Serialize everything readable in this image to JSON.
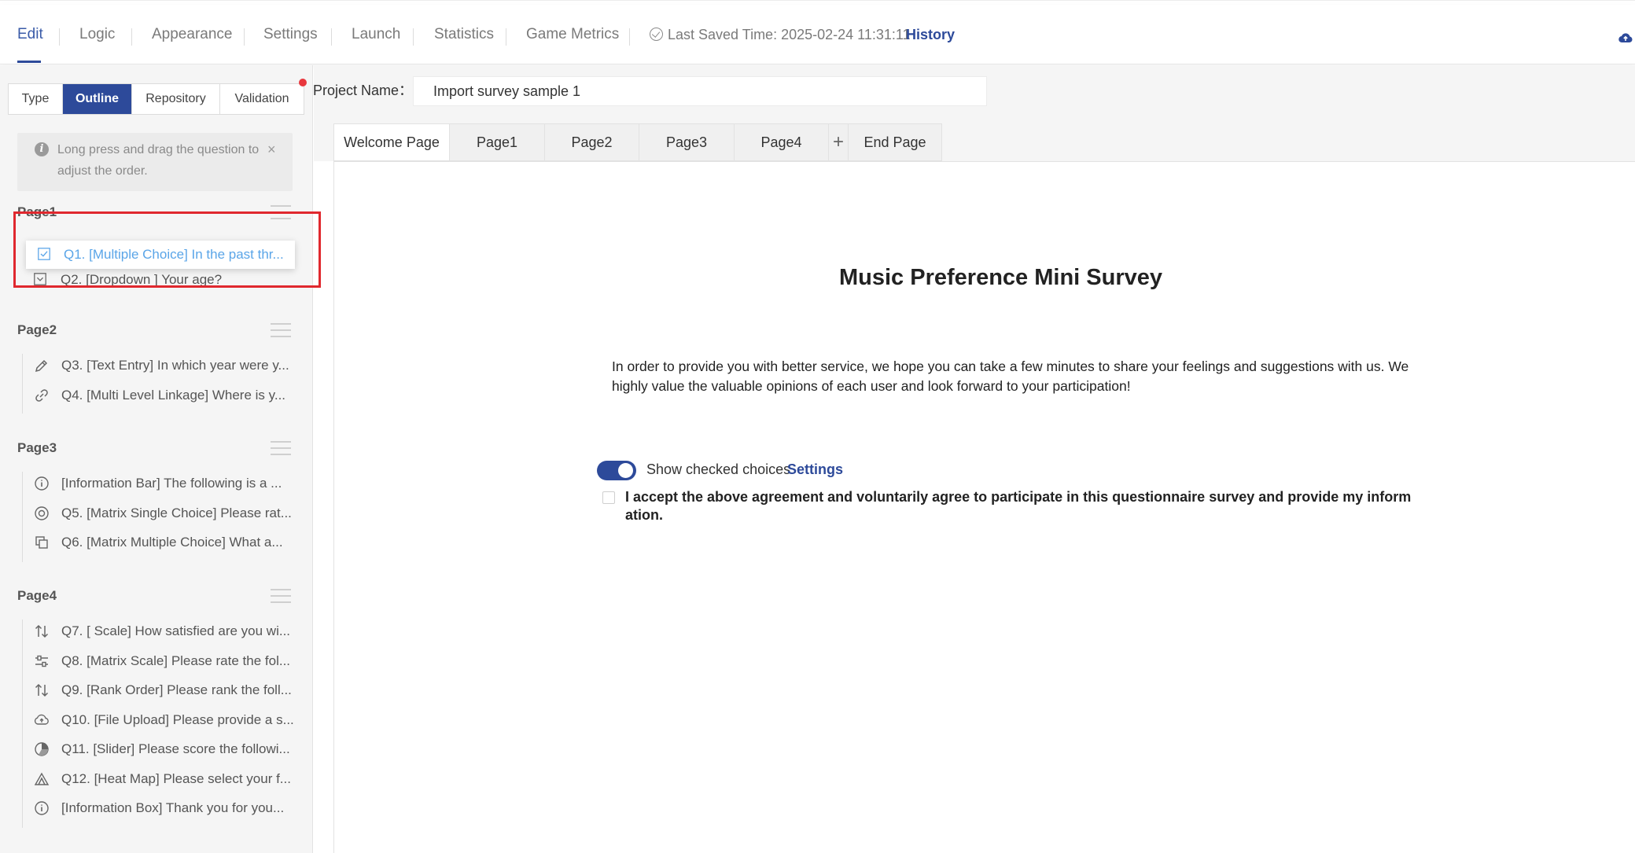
{
  "topnav": {
    "tabs": [
      "Edit",
      "Logic",
      "Appearance",
      "Settings",
      "Launch",
      "Statistics",
      "Game Metrics"
    ],
    "active_tab": "Edit",
    "last_saved": "Last Saved Time: 2025-02-24 11:31:11",
    "history_label": "History",
    "cloud_icon": "cloud-upload-icon"
  },
  "sidebar": {
    "tabs": [
      "Type",
      "Outline",
      "Repository",
      "Validation"
    ],
    "active_tab": "Outline",
    "tip": "Long press and drag the question to adjust the order.",
    "tip_close": "×",
    "pages": [
      {
        "label": "Page1",
        "items": [
          {
            "icon": "checkbox-icon",
            "text": "Q1. [Multiple Choice] In the past thr..."
          },
          {
            "icon": "dropdown-icon",
            "text": "Q2. [Dropdown ] Your age?"
          }
        ]
      },
      {
        "label": "Page2",
        "items": [
          {
            "icon": "pencil-icon",
            "text": "Q3. [Text Entry] In which year were y..."
          },
          {
            "icon": "link-icon",
            "text": "Q4. [Multi Level Linkage] Where is y..."
          }
        ]
      },
      {
        "label": "Page3",
        "items": [
          {
            "icon": "info-icon",
            "text": "[Information Bar] The following is a ..."
          },
          {
            "icon": "radio-icon",
            "text": "Q5. [Matrix Single Choice] Please rat..."
          },
          {
            "icon": "copy-icon",
            "text": "Q6. [Matrix Multiple Choice] What a..."
          }
        ]
      },
      {
        "label": "Page4",
        "items": [
          {
            "icon": "sort-arrows-icon",
            "text": "Q7. [ Scale] How satisfied are you wi..."
          },
          {
            "icon": "sliders-icon",
            "text": "Q8. [Matrix Scale] Please rate the fol..."
          },
          {
            "icon": "sort-arrows-icon",
            "text": "Q9. [Rank Order] Please rank the foll..."
          },
          {
            "icon": "upload-icon",
            "text": "Q10. [File Upload] Please provide a s..."
          },
          {
            "icon": "pie-icon",
            "text": "Q11. [Slider] Please score the followi..."
          },
          {
            "icon": "heatmap-icon",
            "text": "Q12. [Heat Map] Please select your f..."
          },
          {
            "icon": "info-icon",
            "text": "[Information Box] Thank you for you..."
          }
        ]
      }
    ]
  },
  "project": {
    "label": "Project Name：",
    "value": "Import survey sample 1"
  },
  "page_tabs": [
    "Welcome Page",
    "Page1",
    "Page2",
    "Page3",
    "Page4",
    "+",
    "End Page"
  ],
  "survey": {
    "title": "Music Preference Mini Survey",
    "description": "In order to provide you with better service, we hope you can take a few minutes to share your feelings and suggestions with us. We highly value the valuable opinions of each user and look forward to your participation!",
    "toggle_label": "Show checked choices",
    "toggle_on": true,
    "settings_label": "Settings",
    "agreement": "I accept the above agreement and voluntarily agree to participate in this questionnaire survey and provide my information."
  },
  "colors": {
    "accent": "#2d4a9a",
    "drag_text": "#5aa5e8",
    "highlight": "#e0282e"
  }
}
